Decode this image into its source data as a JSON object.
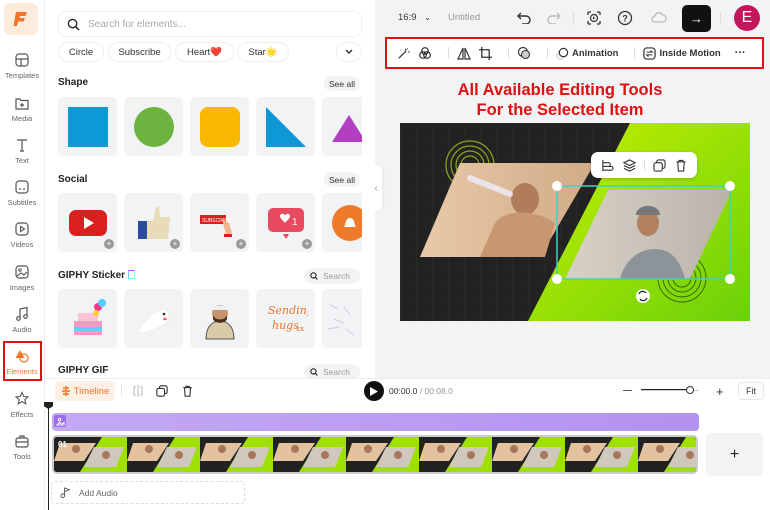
{
  "sidebar": {
    "items": [
      {
        "label": "Templates",
        "icon": "templates-icon"
      },
      {
        "label": "Media",
        "icon": "media-folder-icon"
      },
      {
        "label": "Text",
        "icon": "text-icon"
      },
      {
        "label": "Subtitles",
        "icon": "subtitles-icon"
      },
      {
        "label": "Videos",
        "icon": "videos-icon"
      },
      {
        "label": "Images",
        "icon": "images-icon"
      },
      {
        "label": "Audio",
        "icon": "audio-icon"
      },
      {
        "label": "Elements",
        "icon": "elements-icon",
        "active": true
      },
      {
        "label": "Effects",
        "icon": "effects-icon"
      },
      {
        "label": "Tools",
        "icon": "tools-icon"
      }
    ],
    "accent": "#f2742b"
  },
  "panel": {
    "search_placeholder": "Search for elements...",
    "chips": [
      "Circle",
      "Subscribe",
      "Heart❤️",
      "Star🌟"
    ],
    "sections": {
      "shape": {
        "title": "Shape",
        "see_all": "See all",
        "items": [
          "blue-square",
          "green-circle",
          "yellow-rounded-square",
          "blue-right-triangle",
          "purple-triangle"
        ]
      },
      "social": {
        "title": "Social",
        "see_all": "See all",
        "items": [
          "youtube-play",
          "thumbs-up",
          "subscribe-click",
          "like-notification",
          "bell"
        ]
      },
      "giphy_sticker": {
        "title": "GIPHY Sticker",
        "search": "Search",
        "items": [
          "birthday-cake-hearts",
          "white-seal",
          "man-hand-on-heart",
          "sending-hugs-xx",
          "sketch"
        ]
      },
      "giphy_gif": {
        "title": "GIPHY GIF",
        "search": "Search"
      }
    }
  },
  "topbar": {
    "ratio": "16:9",
    "title": "Untitled",
    "export_icon": "→",
    "avatar_letter": "E"
  },
  "edit_toolbar": {
    "animation": "Animation",
    "inside_motion": "Inside Motion",
    "more": "···"
  },
  "annotation": {
    "line1": "All Available Editing Tools",
    "line2": "For the Selected Item",
    "color": "#dd1111"
  },
  "timeline": {
    "label": "Timeline",
    "current_time": "00:00.0",
    "total_time": "/ 00:08.0",
    "fit": "Fit",
    "zoom_level": 0.85,
    "clip_number": "01",
    "frames": 9,
    "add_audio": "Add Audio",
    "add_clip": "+"
  }
}
